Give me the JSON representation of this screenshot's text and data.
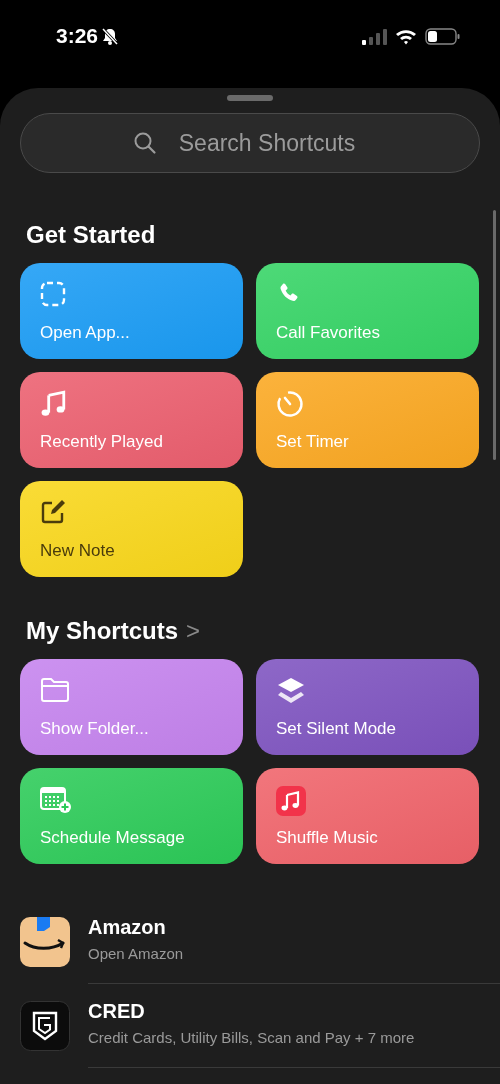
{
  "status_bar": {
    "time": "3:26"
  },
  "search": {
    "placeholder": "Search Shortcuts"
  },
  "get_started": {
    "title": "Get Started",
    "tiles": [
      {
        "label": "Open App...",
        "color": "#1a9cf5",
        "dark_text": false
      },
      {
        "label": "Call Favorites",
        "color": "#35d465",
        "dark_text": false
      },
      {
        "label": "Recently Played",
        "color": "#ec5f6f",
        "dark_text": false
      },
      {
        "label": "Set Timer",
        "color": "#fba821",
        "dark_text": false
      },
      {
        "label": "New Note",
        "color": "#f9d71a",
        "dark_text": true
      }
    ]
  },
  "my_shortcuts": {
    "title": "My Shortcuts",
    "chevron": ">",
    "tiles": [
      {
        "label": "Show Folder...",
        "color": "#c583ee",
        "dark_text": false
      },
      {
        "label": "Set Silent Mode",
        "color": "#7e53c0",
        "dark_text": false
      },
      {
        "label": "Schedule Message",
        "color": "#2ccb58",
        "dark_text": false
      },
      {
        "label": "Shuffle Music",
        "color": "#f0636a",
        "dark_text": false
      }
    ]
  },
  "apps": [
    {
      "name": "Amazon",
      "subtitle": "Open Amazon"
    },
    {
      "name": "CRED",
      "subtitle": "Credit Cards, Utility Bills, Scan and Pay + 7 more"
    }
  ]
}
